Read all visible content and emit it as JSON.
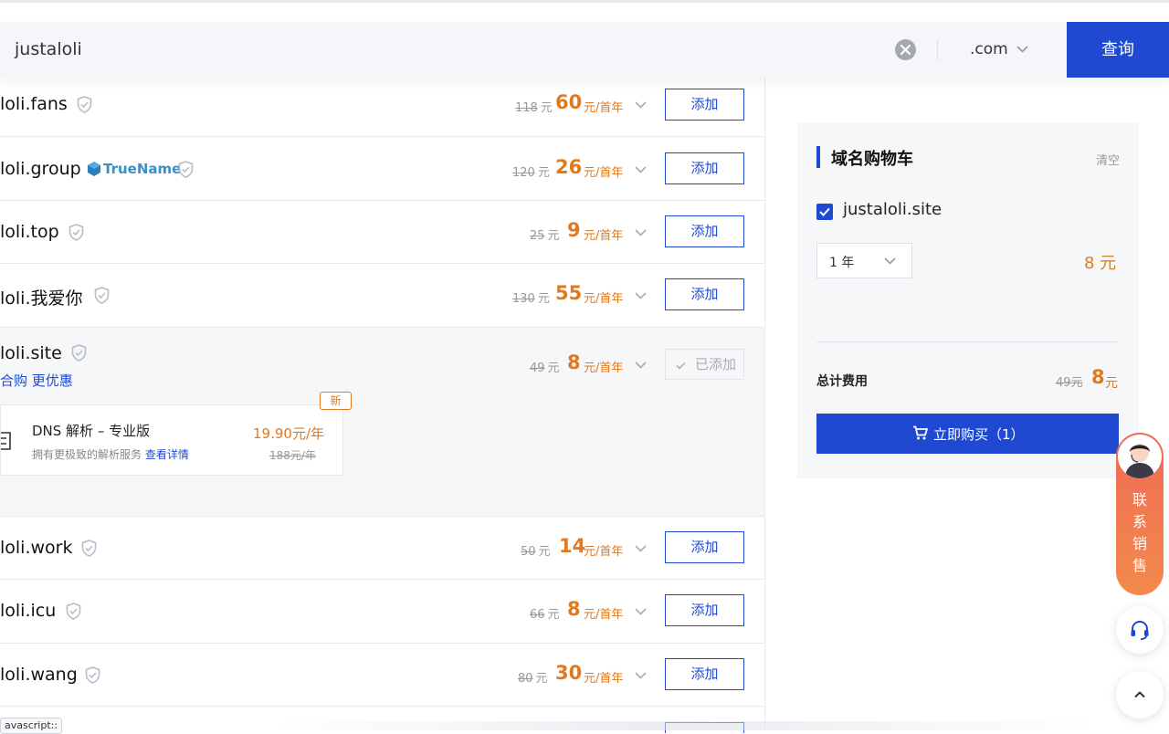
{
  "search": {
    "value": "justaloli",
    "suffix": ".com",
    "button_label": "查询"
  },
  "domains": [
    {
      "name": "loli.fans",
      "old_price": "118",
      "price": "60",
      "currency": "元",
      "unit": "元/首年",
      "action": "添加"
    },
    {
      "name": "loli.group",
      "badge": "TrueName",
      "old_price": "120",
      "price": "26",
      "currency": "元",
      "unit": "元/首年",
      "action": "添加"
    },
    {
      "name": "loli.top",
      "old_price": "25",
      "price": "9",
      "currency": "元",
      "unit": "元/首年",
      "action": "添加"
    },
    {
      "name": "loli.我爱你",
      "old_price": "130",
      "price": "55",
      "currency": "元",
      "unit": "元/首年",
      "action": "添加"
    },
    {
      "name": "loli.site",
      "old_price": "49",
      "price": "8",
      "currency": "元",
      "unit": "元/首年",
      "action": "已添加",
      "promo": "合购 更优惠",
      "bundle": {
        "title": "DNS 解析 – 专业版",
        "desc": "拥有更极致的解析服务",
        "link": "查看详情",
        "price": "19.90元/年",
        "old_price": "188元/年",
        "tag": "新"
      }
    },
    {
      "name": "loli.work",
      "old_price": "50",
      "price": "14",
      "currency": "元",
      "unit": "元/首年",
      "action": "添加"
    },
    {
      "name": "loli.icu",
      "old_price": "66",
      "price": "8",
      "currency": "元",
      "unit": "元/首年",
      "action": "添加"
    },
    {
      "name": "loli.wang",
      "old_price": "80",
      "price": "30",
      "currency": "元",
      "unit": "元/首年",
      "action": "添加"
    }
  ],
  "footer_chip": "avascript::",
  "cart": {
    "title": "域名购物车",
    "clear": "清空",
    "item": "justaloli.site",
    "period": "1 年",
    "item_price": "8 元",
    "total_label": "总计费用",
    "total_old": "49元",
    "total_price": "8",
    "total_unit": "元",
    "buy_label": "立即购买（1）"
  },
  "sales_widget": {
    "label": "联\n系\n销\n售"
  },
  "colors": {
    "primary": "#1f49d1",
    "price": "#e07a1f"
  }
}
